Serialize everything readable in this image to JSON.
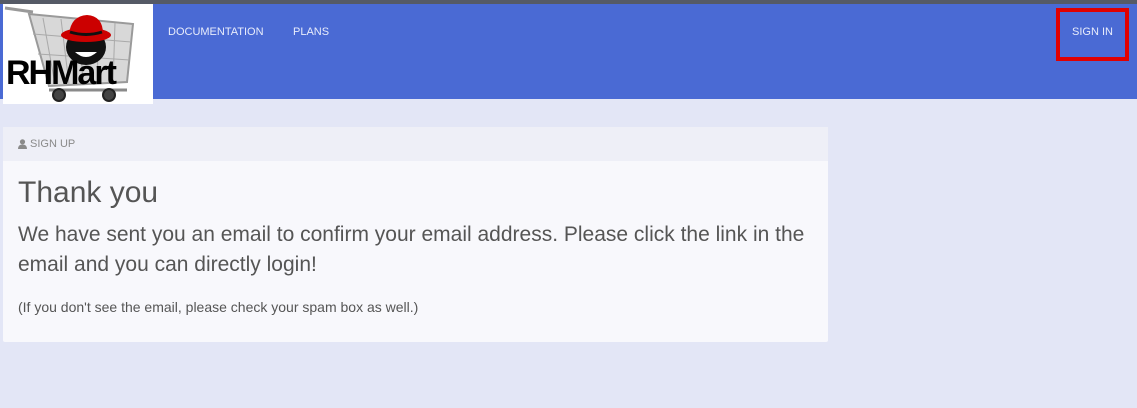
{
  "brand": {
    "logo_text": "RHMart",
    "logo_icon": "shopping-cart-with-fedora-icon"
  },
  "nav": {
    "documentation": "DOCUMENTATION",
    "plans": "PLANS",
    "sign_in": "SIGN IN"
  },
  "card": {
    "header_icon": "user-icon",
    "header_label": "SIGN UP",
    "title": "Thank you",
    "message": "We have sent you an email to confirm your email address. Please click the link in the email and you can directly login!",
    "note": "(If you don't see the email, please check your spam box as well.)"
  },
  "colors": {
    "header_bg": "#4a6ad4",
    "page_bg": "#e3e6f6",
    "highlight": "#e00000"
  }
}
